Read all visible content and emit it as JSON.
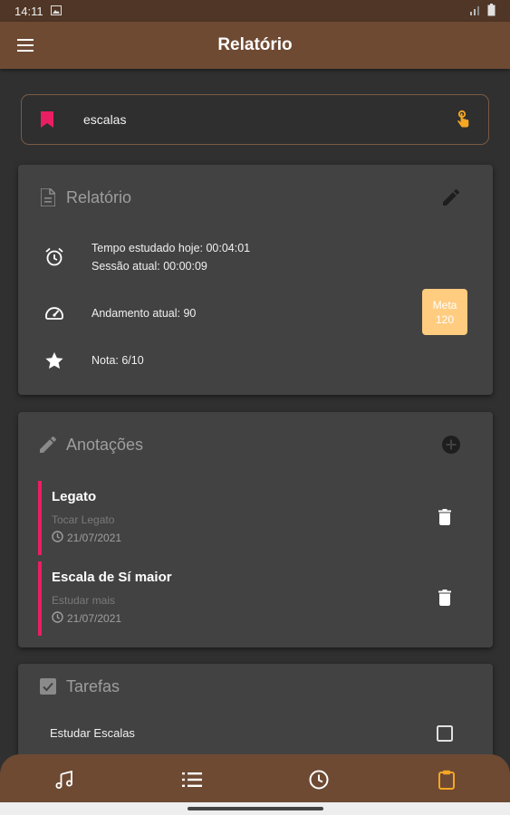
{
  "status_bar": {
    "time": "14:11"
  },
  "app_bar": {
    "title": "Relatório"
  },
  "search": {
    "value": "escalas"
  },
  "report": {
    "title": "Relatório",
    "study_today": "Tempo estudado hoje: 00:04:01",
    "current_session": "Sessão atual: 00:00:09",
    "current_tempo": "Andamento atual: 90",
    "goal_label": "Meta",
    "goal_value": "120",
    "grade": "Nota: 6/10"
  },
  "notes": {
    "title": "Anotações",
    "items": [
      {
        "title": "Legato",
        "description": "Tocar Legato",
        "date": "21/07/2021"
      },
      {
        "title": "Escala de Sí maior",
        "description": "Estudar mais",
        "date": "21/07/2021"
      }
    ]
  },
  "tasks": {
    "title": "Tarefas",
    "items": [
      {
        "label": "Estudar Escalas",
        "checked": false
      }
    ]
  },
  "bottom_nav": {
    "items": [
      {
        "icon": "music-note-icon",
        "active": false
      },
      {
        "icon": "list-icon",
        "active": false
      },
      {
        "icon": "clock-icon",
        "active": false
      },
      {
        "icon": "clipboard-icon",
        "active": true
      }
    ]
  },
  "colors": {
    "app_bar": "#6e4a33",
    "status_bar": "#503626",
    "background": "#303030",
    "card": "#424242",
    "accent_pink": "#e91e63",
    "accent_orange": "#f5a623",
    "goal_badge": "#ffcc80"
  }
}
